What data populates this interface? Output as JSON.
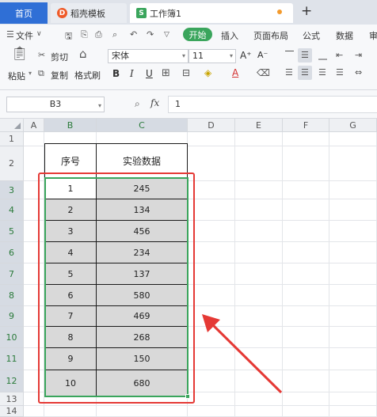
{
  "tabs": {
    "home": "首页",
    "template": "稻壳模板",
    "template_logo": "D",
    "workbook": "工作簿1",
    "workbook_logo": "S",
    "new_tab": "+"
  },
  "menu": {
    "file": "文件",
    "start": "开始",
    "insert": "插入",
    "page_layout": "页面布局",
    "formula": "公式",
    "data": "数据",
    "review_partial": "审"
  },
  "ribbon": {
    "paste": "粘贴",
    "cut": "剪切",
    "copy": "复制",
    "format_painter": "格式刷",
    "font_name": "宋体",
    "font_size": "11",
    "bold": "B",
    "italic": "I",
    "underline": "U",
    "grow_font": "A⁺",
    "shrink_font": "A⁻"
  },
  "formula_bar": {
    "cell_ref": "B3",
    "fx": "fx",
    "value": "1"
  },
  "columns": [
    "A",
    "B",
    "C",
    "D",
    "E",
    "F",
    "G"
  ],
  "rows": [
    "1",
    "2",
    "3",
    "4",
    "5",
    "6",
    "7",
    "8",
    "9",
    "10",
    "11",
    "12",
    "13",
    "14"
  ],
  "table": {
    "header_seq": "序号",
    "header_data": "实验数据",
    "seq": [
      "1",
      "2",
      "3",
      "4",
      "5",
      "6",
      "7",
      "8",
      "9",
      "10"
    ],
    "values": [
      "245",
      "134",
      "456",
      "234",
      "137",
      "580",
      "469",
      "268",
      "150",
      "680"
    ]
  },
  "colors": {
    "accent_green": "#3aa55c",
    "annotation_red": "#e53935",
    "home_tab_blue": "#2f6fd6",
    "cell_shade": "#d9d9d9"
  }
}
